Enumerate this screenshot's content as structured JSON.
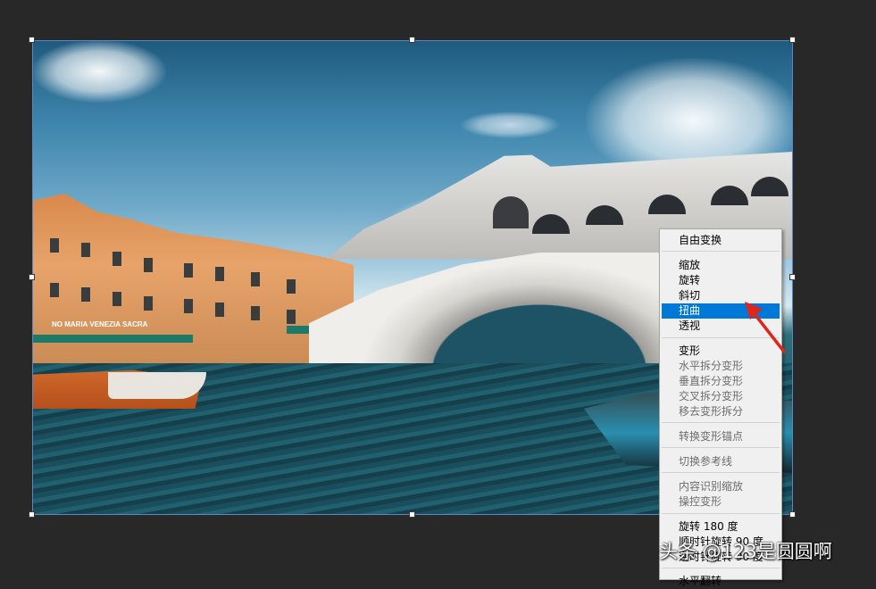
{
  "context_menu": {
    "items": [
      {
        "label": "自由变换",
        "state": "enabled"
      },
      {
        "label": "缩放",
        "state": "enabled"
      },
      {
        "label": "旋转",
        "state": "enabled"
      },
      {
        "label": "斜切",
        "state": "enabled"
      },
      {
        "label": "扭曲",
        "state": "highlighted"
      },
      {
        "label": "透视",
        "state": "enabled"
      },
      {
        "label": "变形",
        "state": "enabled"
      },
      {
        "label": "水平拆分变形",
        "state": "disabled"
      },
      {
        "label": "垂直拆分变形",
        "state": "disabled"
      },
      {
        "label": "交叉拆分变形",
        "state": "disabled"
      },
      {
        "label": "移去变形拆分",
        "state": "disabled"
      },
      {
        "label": "转换变形锚点",
        "state": "disabled"
      },
      {
        "label": "切换参考线",
        "state": "disabled"
      },
      {
        "label": "内容识别缩放",
        "state": "disabled"
      },
      {
        "label": "操控变形",
        "state": "disabled"
      },
      {
        "label": "旋转 180 度",
        "state": "enabled"
      },
      {
        "label": "顺时针旋转 90 度",
        "state": "enabled"
      },
      {
        "label": "逆时针旋转 90 度",
        "state": "enabled"
      },
      {
        "label": "水平翻转",
        "state": "enabled"
      }
    ]
  },
  "photo": {
    "signs": {
      "hotel_sign": "NO MARIA VENEZIA SACRA"
    }
  },
  "watermark": "头条 @123是圆圆啊",
  "colors": {
    "canvas_background": "#282828",
    "menu_background": "#f0f0f0",
    "menu_highlight": "#0078d7",
    "bbox_border": "#5a86c7",
    "arrow": "#e0251b"
  },
  "icons": [
    "red-arrow-annotation-icon"
  ]
}
